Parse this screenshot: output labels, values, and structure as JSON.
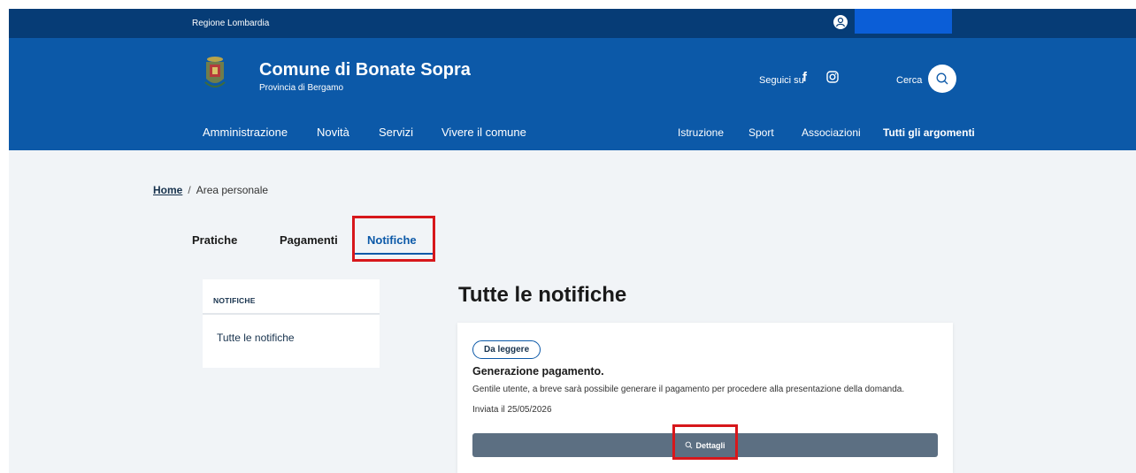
{
  "topbar": {
    "region": "Regione Lombardia"
  },
  "header": {
    "title": "Comune di Bonate Sopra",
    "subtitle": "Provincia di Bergamo",
    "follow_label": "Seguici su",
    "search_label": "Cerca"
  },
  "nav": {
    "main": [
      "Amministrazione",
      "Novità",
      "Servizi",
      "Vivere il comune"
    ],
    "topics": [
      "Istruzione",
      "Sport",
      "Associazioni"
    ],
    "all_topics": "Tutti gli argomenti"
  },
  "breadcrumb": {
    "home": "Home",
    "current": "Area personale"
  },
  "tabs": [
    "Pratiche",
    "Pagamenti",
    "Notifiche"
  ],
  "active_tab": "Notifiche",
  "sidebar": {
    "title": "NOTIFICHE",
    "link": "Tutte le notifiche"
  },
  "main": {
    "title": "Tutte le notifiche",
    "notification": {
      "badge": "Da leggere",
      "title": "Generazione pagamento.",
      "body": "Gentile utente, a breve sarà possibile generare il pagamento per procedere alla presentazione della domanda.",
      "date": "Inviata il 25/05/2026",
      "button": "Dettagli"
    }
  },
  "icons": [
    "user-icon",
    "facebook-icon",
    "instagram-icon",
    "search-icon",
    "crest-icon"
  ],
  "colors": {
    "topbar": "#063c76",
    "header": "#0c59a8",
    "button": "#5c6f82",
    "highlight": "#d7171b"
  }
}
